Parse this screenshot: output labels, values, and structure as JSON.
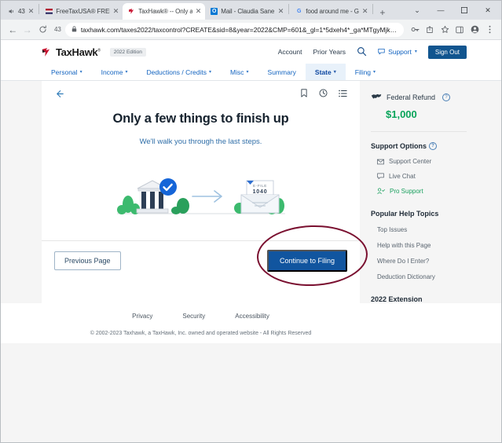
{
  "browser": {
    "tabs": [
      {
        "title": "43",
        "icon": "audio-speaker-icon",
        "active": false
      },
      {
        "title": "FreeTaxUSA® FREE T",
        "icon": "freetaxusa-flag-icon",
        "active": false
      },
      {
        "title": "TaxHawk® -- Only a",
        "icon": "taxhawk-icon",
        "active": true
      },
      {
        "title": "Mail - Claudia Sane -",
        "icon": "outlook-mail-icon",
        "active": false
      },
      {
        "title": "food around me - G",
        "icon": "google-icon",
        "active": false
      }
    ],
    "new_tab_label": "+",
    "window_controls": {
      "collapse": "⌄",
      "minimize": "—",
      "maximize": "❐",
      "close": "✕"
    },
    "toolbar": {
      "back": "←",
      "forward": "→",
      "reload": "C",
      "reload_badge": "43",
      "lock": "🔒",
      "url": "taxhawk.com/taxes2022/taxcontrol?CREATE&sid=8&year=2022&CMP=601&_gl=1*5dxeh4*_ga*MTgyMjkyNTAwNC4xNjc0NzM...",
      "icons": [
        "key-icon",
        "share-icon",
        "star-icon",
        "sidepanel-icon",
        "profile-icon",
        "menu-icon"
      ]
    }
  },
  "site_header": {
    "logo_text_1": "Tax",
    "logo_text_2": "Hawk",
    "registered": "®",
    "edition_badge": "2022 Edition",
    "links": [
      "Account",
      "Prior Years"
    ],
    "search_label": "Search",
    "support_label": "Support",
    "sign_out_label": "Sign Out"
  },
  "nav": {
    "items": [
      {
        "label": "Personal",
        "caret": true,
        "active": false
      },
      {
        "label": "Income",
        "caret": true,
        "active": false
      },
      {
        "label": "Deductions / Credits",
        "caret": true,
        "active": false
      },
      {
        "label": "Misc",
        "caret": true,
        "active": false
      },
      {
        "label": "Summary",
        "caret": false,
        "active": false
      },
      {
        "label": "State",
        "caret": true,
        "active": true
      },
      {
        "label": "Filing",
        "caret": true,
        "active": false
      }
    ]
  },
  "main": {
    "back_arrow": "←",
    "tool_icons": [
      "bookmark-icon",
      "clock-icon",
      "list-icon"
    ],
    "heading": "Only a few things to finish up",
    "subheading": "We'll walk you through the last steps.",
    "illustration": {
      "document_label_top": "E-FILE",
      "document_label_form": "1040",
      "alt": "government building with checkmark, arrow, and envelope with 1040 e-file form"
    },
    "previous_button": "Previous Page",
    "continue_button": "Continue to Filing"
  },
  "sidebar": {
    "refund_label": "Federal Refund",
    "refund_amount": "$1,000",
    "refund_color": "#0aa45a",
    "support_options_title": "Support Options",
    "support_links": [
      {
        "label": "Support Center",
        "icon": "envelope-icon",
        "style": "gray"
      },
      {
        "label": "Live Chat",
        "icon": "chat-bubble-icon",
        "style": "gray"
      },
      {
        "label": "Pro Support",
        "icon": "person-check-icon",
        "style": "green"
      }
    ],
    "help_topics_title": "Popular Help Topics",
    "help_topics": [
      "Top Issues",
      "Help with this Page",
      "Where Do I Enter?",
      "Deduction Dictionary"
    ],
    "extension_title": "2022 Extension"
  },
  "footer": {
    "links": [
      "Privacy",
      "Security",
      "Accessibility"
    ],
    "copyright": "© 2002-2023 Taxhawk, a TaxHawk, Inc. owned and operated website - All Rights Reserved"
  },
  "annotation": {
    "shape": "ellipse",
    "color": "#7a1030",
    "targets": "continue-to-filing-button"
  }
}
